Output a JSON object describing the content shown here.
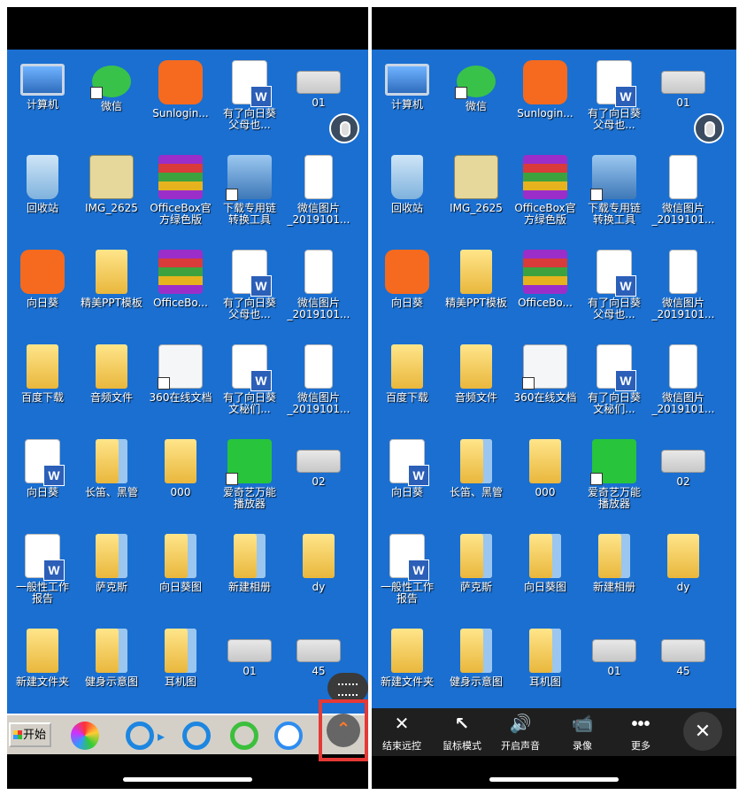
{
  "desktop": {
    "rows": [
      [
        {
          "label": "计算机",
          "art": "computer"
        },
        {
          "label": "微信",
          "art": "wechat"
        },
        {
          "label": "Sunlogin...",
          "art": "sunlogin"
        },
        {
          "label": "有了向日葵\n父母也...",
          "art": "doc"
        },
        {
          "label": "01",
          "art": "thumb"
        }
      ],
      [
        {
          "label": "回收站",
          "art": "recycle"
        },
        {
          "label": "IMG_2625",
          "art": "photo"
        },
        {
          "label": "OfficeBox官\n方绿色版",
          "art": "rar"
        },
        {
          "label": "下载专用链\n转换工具",
          "art": "tool"
        },
        {
          "label": "微信图片\n_2019101...",
          "art": "image"
        }
      ],
      [
        {
          "label": "向日葵",
          "art": "sunlogin"
        },
        {
          "label": "精美PPT模板",
          "art": "folder"
        },
        {
          "label": "OfficeBo...",
          "art": "rar"
        },
        {
          "label": "有了向日葵\n父母也...",
          "art": "doc"
        },
        {
          "label": "微信图片\n_2019101...",
          "art": "image"
        }
      ],
      [
        {
          "label": "百度下载",
          "art": "folder"
        },
        {
          "label": "音频文件",
          "art": "folder"
        },
        {
          "label": "360在线文档",
          "art": "360"
        },
        {
          "label": "有了向日葵\n文秘们...",
          "art": "doc"
        },
        {
          "label": "微信图片\n_2019101...",
          "art": "image"
        }
      ],
      [
        {
          "label": "向日葵",
          "art": "doc"
        },
        {
          "label": "长笛、黑管",
          "art": "folder2"
        },
        {
          "label": "000",
          "art": "folder"
        },
        {
          "label": "爱奇艺万能\n播放器",
          "art": "iqiyi"
        },
        {
          "label": "02",
          "art": "thumb"
        }
      ],
      [
        {
          "label": "一般性工作\n报告",
          "art": "doc"
        },
        {
          "label": "萨克斯",
          "art": "folder2"
        },
        {
          "label": "向日葵图",
          "art": "folder2"
        },
        {
          "label": "新建相册",
          "art": "folder2"
        },
        {
          "label": "dy",
          "art": "folder"
        }
      ],
      [
        {
          "label": "新建文件夹",
          "art": "folder"
        },
        {
          "label": "健身示意图",
          "art": "folder2"
        },
        {
          "label": "耳机图",
          "art": "folder2"
        },
        {
          "label": "01",
          "art": "thumb"
        },
        {
          "label": "45",
          "art": "thumb"
        }
      ]
    ]
  },
  "taskbar": {
    "start_label": "开始"
  },
  "toolbar": {
    "items": [
      {
        "icon": "close-x-icon",
        "glyph": "✕",
        "label": "结束远控"
      },
      {
        "icon": "cursor-icon",
        "glyph": "↖",
        "label": "鼠标模式"
      },
      {
        "icon": "speaker-icon",
        "glyph": "🔊",
        "label": "开启声音"
      },
      {
        "icon": "camera-icon",
        "glyph": "📹",
        "label": "录像"
      },
      {
        "icon": "more-icon",
        "glyph": "•••",
        "label": "更多"
      }
    ],
    "collapse_glyph": "✕"
  },
  "colors": {
    "desktop_bg": "#1a6fd1",
    "highlight": "#e53935",
    "toolbar_bg": "#1f1f1f"
  }
}
